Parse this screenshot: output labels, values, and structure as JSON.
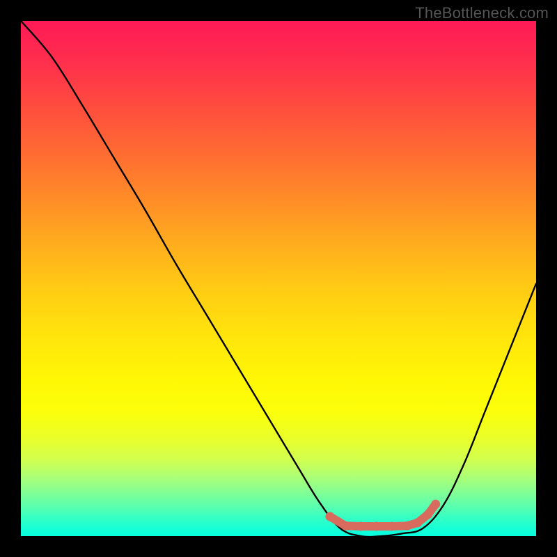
{
  "attribution": "TheBottleneck.com",
  "colors": {
    "page_bg": "#000000",
    "gradient_top": "#ff1a56",
    "gradient_mid": "#ffe40c",
    "gradient_bottom": "#08ffe2",
    "curve": "#000000",
    "marker": "#d86a5e"
  },
  "chart_data": {
    "type": "line",
    "title": "",
    "xlabel": "",
    "ylabel": "",
    "xlim": [
      0,
      100
    ],
    "ylim": [
      0,
      100
    ],
    "note": "Axes have no tick labels; values are relative (0–100) estimates from pixel positions, where y represents bottleneck percentage (0 = no bottleneck / green, 100 = top of chart / red).",
    "series": [
      {
        "name": "bottleneck-curve",
        "x": [
          0,
          6,
          12,
          18,
          24,
          30,
          36,
          42,
          48,
          54,
          58,
          62,
          66,
          70,
          74,
          78,
          82,
          86,
          90,
          94,
          98,
          100
        ],
        "y": [
          100,
          93,
          83.5,
          73.5,
          63.5,
          53,
          43,
          33,
          23,
          13,
          6.5,
          1.5,
          0,
          0,
          0.5,
          1.5,
          6,
          14,
          24,
          34,
          44,
          49
        ]
      }
    ],
    "markers": {
      "name": "optimal-band",
      "color": "#d86a5e",
      "points": [
        {
          "x": 60,
          "y": 3.8
        },
        {
          "x": 63,
          "y": 2.0
        },
        {
          "x": 66,
          "y": 1.9
        },
        {
          "x": 69,
          "y": 1.9
        },
        {
          "x": 72,
          "y": 1.9
        },
        {
          "x": 75,
          "y": 2.0
        },
        {
          "x": 77,
          "y": 2.6
        },
        {
          "x": 79,
          "y": 4.2
        },
        {
          "x": 80.5,
          "y": 6.2
        }
      ]
    }
  }
}
